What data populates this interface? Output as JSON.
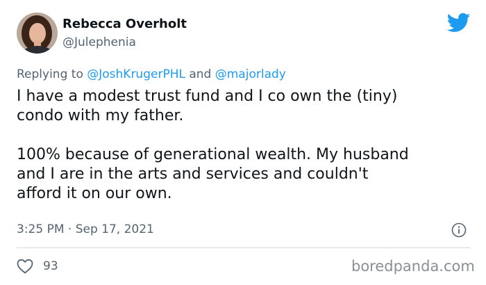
{
  "author": {
    "name": "Rebecca Overholt",
    "handle": "@Julephenia",
    "avatar_icon": "profile-photo"
  },
  "brand_icon": "twitter-bird-icon",
  "brand_color": "#1d9bf0",
  "reply": {
    "prefix": "Replying to",
    "mention_1": "@JoshKrugerPHL",
    "conjunction": "and",
    "mention_2": "@majorlady"
  },
  "tweet": {
    "lines": [
      "I have a modest trust fund and I co own the (tiny)",
      "condo with my father.",
      "100% because of generational wealth. My husband",
      "and I are in the arts and services and couldn't",
      "afford it on our own."
    ]
  },
  "meta": {
    "timestamp": "3:25 PM · Sep 17, 2021",
    "info_icon": "info-icon"
  },
  "stats": {
    "like_icon": "heart-icon",
    "likes": "93"
  },
  "watermark": "boredpanda.com"
}
